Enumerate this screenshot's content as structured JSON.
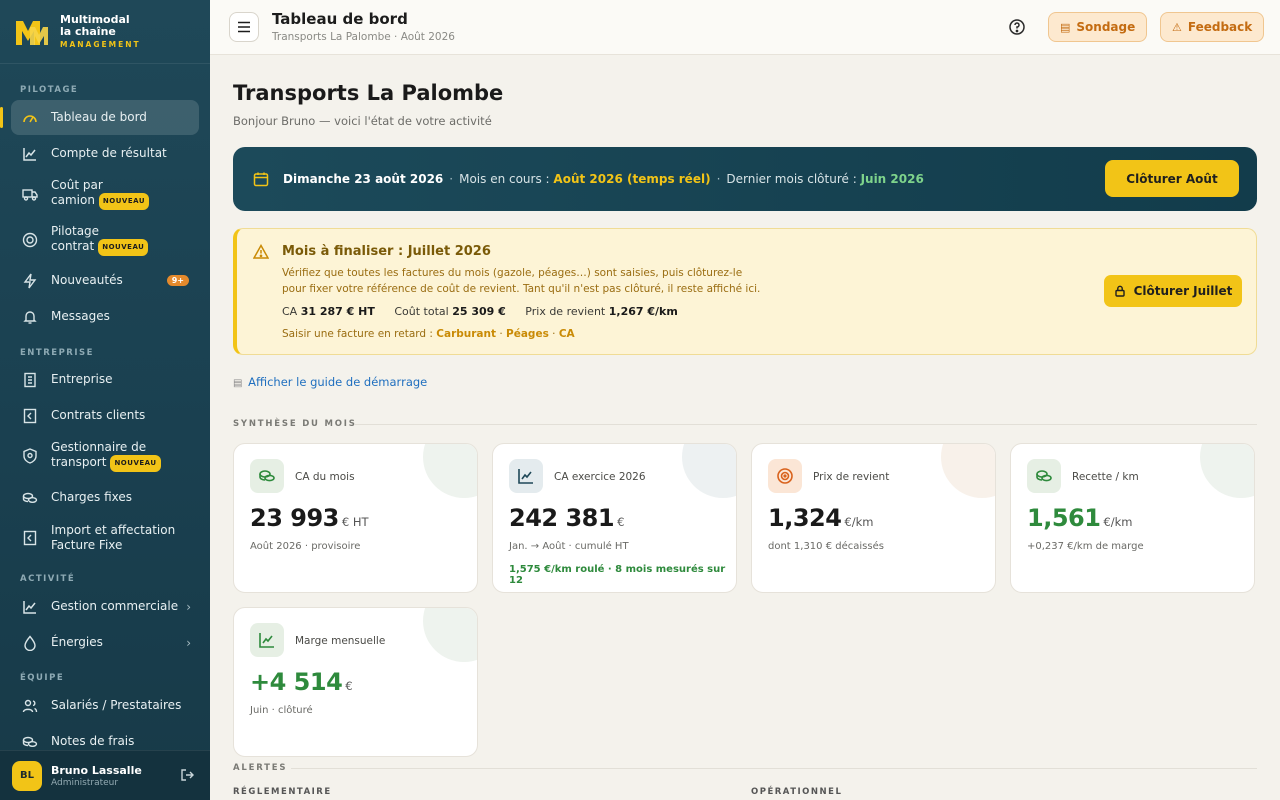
{
  "brand": {
    "line1": "Multimodal",
    "line2": "la chaîne",
    "line3": "MANAGEMENT"
  },
  "sidebar": {
    "sections": {
      "pilotage": "PILOTAGE",
      "entreprise": "ENTREPRISE",
      "activite": "ACTIVITÉ",
      "equipe": "ÉQUIPE"
    },
    "items": [
      {
        "label": "Tableau de bord",
        "icon": "gauge-icon",
        "active": true
      },
      {
        "label": "Compte de résultat",
        "icon": "chart-line-icon"
      },
      {
        "label": "Coût par camion",
        "icon": "truck-icon",
        "badge": "NOUVEAU"
      },
      {
        "label": "Pilotage contrat",
        "icon": "target-icon",
        "badge": "NOUVEAU"
      },
      {
        "label": "Nouveautés",
        "icon": "bolt-icon",
        "count": "9+"
      },
      {
        "label": "Messages",
        "icon": "bell-icon"
      },
      {
        "label": "Entreprise",
        "icon": "building-icon"
      },
      {
        "label": "Contrats clients",
        "icon": "contract-icon"
      },
      {
        "label": "Gestionnaire de transport",
        "icon": "shield-icon",
        "badge": "NOUVEAU"
      },
      {
        "label": "Charges fixes",
        "icon": "coins-icon"
      },
      {
        "label": "Import et affectation Facture Fixe",
        "icon": "import-icon"
      },
      {
        "label": "Gestion commerciale",
        "icon": "chart-line-icon",
        "chevron": true
      },
      {
        "label": "Énergies",
        "icon": "drop-icon",
        "chevron": true
      },
      {
        "label": "Salariés / Prestataires",
        "icon": "users-icon"
      },
      {
        "label": "Notes de frais",
        "icon": "wallet-icon"
      }
    ],
    "user": {
      "initials": "BL",
      "name": "Bruno Lassalle",
      "role": "Administrateur"
    }
  },
  "header": {
    "title": "Tableau de bord",
    "subtitle": "Transports La Palombe · Août 2026",
    "survey_label": "Sondage",
    "feedback_label": "Feedback"
  },
  "page": {
    "title": "Transports La Palombe",
    "subtitle": "Bonjour Bruno — voici l'état de votre activité"
  },
  "banner": {
    "date": "Dimanche 23 août 2026",
    "current_label": "Mois en cours :",
    "current_value": "Août 2026 (temps réel)",
    "last_label": "Dernier mois clôturé :",
    "last_value": "Juin 2026",
    "button": "Clôturer Août"
  },
  "warning": {
    "title_prefix": "Mois à finaliser : ",
    "title_month": "Juillet 2026",
    "text": "Vérifiez que toutes les factures du mois (gazole, péages…) sont saisies, puis clôturez-le pour fixer votre référence de coût de revient. Tant qu'il n'est pas clôturé, il reste affiché ici.",
    "ca_label": "CA",
    "ca_value": "31 287 € HT",
    "cost_label": "Coût total",
    "cost_value": "25 309 €",
    "price_label": "Prix de revient",
    "price_value": "1,267 €/km",
    "late_label": "Saisir une facture en retard :",
    "late_links": [
      "Carburant",
      "Péages",
      "CA"
    ],
    "button": "Clôturer Juillet"
  },
  "guide_link": "Afficher le guide de démarrage",
  "synthesis": {
    "heading": "SYNTHÈSE DU MOIS",
    "cards": [
      {
        "label": "CA du mois",
        "value": "23 993",
        "unit": "€ HT",
        "sub": "Août 2026 · provisoire",
        "icon": "coins-icon"
      },
      {
        "label": "CA exercice 2026",
        "value": "242 381",
        "unit": "€",
        "sub": "Jan. → Août · cumulé HT",
        "note": "1,575 €/km roulé · 8 mois mesurés sur 12",
        "icon": "chart-line-icon"
      },
      {
        "label": "Prix de revient",
        "value": "1,324",
        "unit": "€/km",
        "sub": "dont 1,310 € décaissés",
        "icon": "target-icon"
      },
      {
        "label": "Recette / km",
        "value": "1,561",
        "unit": "€/km",
        "sub": "+0,237 €/km de marge",
        "icon": "coins-icon"
      },
      {
        "label": "Marge mensuelle",
        "value": "+4 514",
        "unit": "€",
        "sub": "Juin · clôturé",
        "icon": "chart-line-icon"
      }
    ]
  },
  "alerts": {
    "heading": "ALERTES",
    "reg": "RÉGLEMENTAIRE",
    "ops": "OPÉRATIONNEL"
  },
  "colors": {
    "sidebar": "#1f4858",
    "accent": "#f2c417",
    "positive": "#2e8a3c",
    "warning_bg": "#fdf4d6"
  }
}
